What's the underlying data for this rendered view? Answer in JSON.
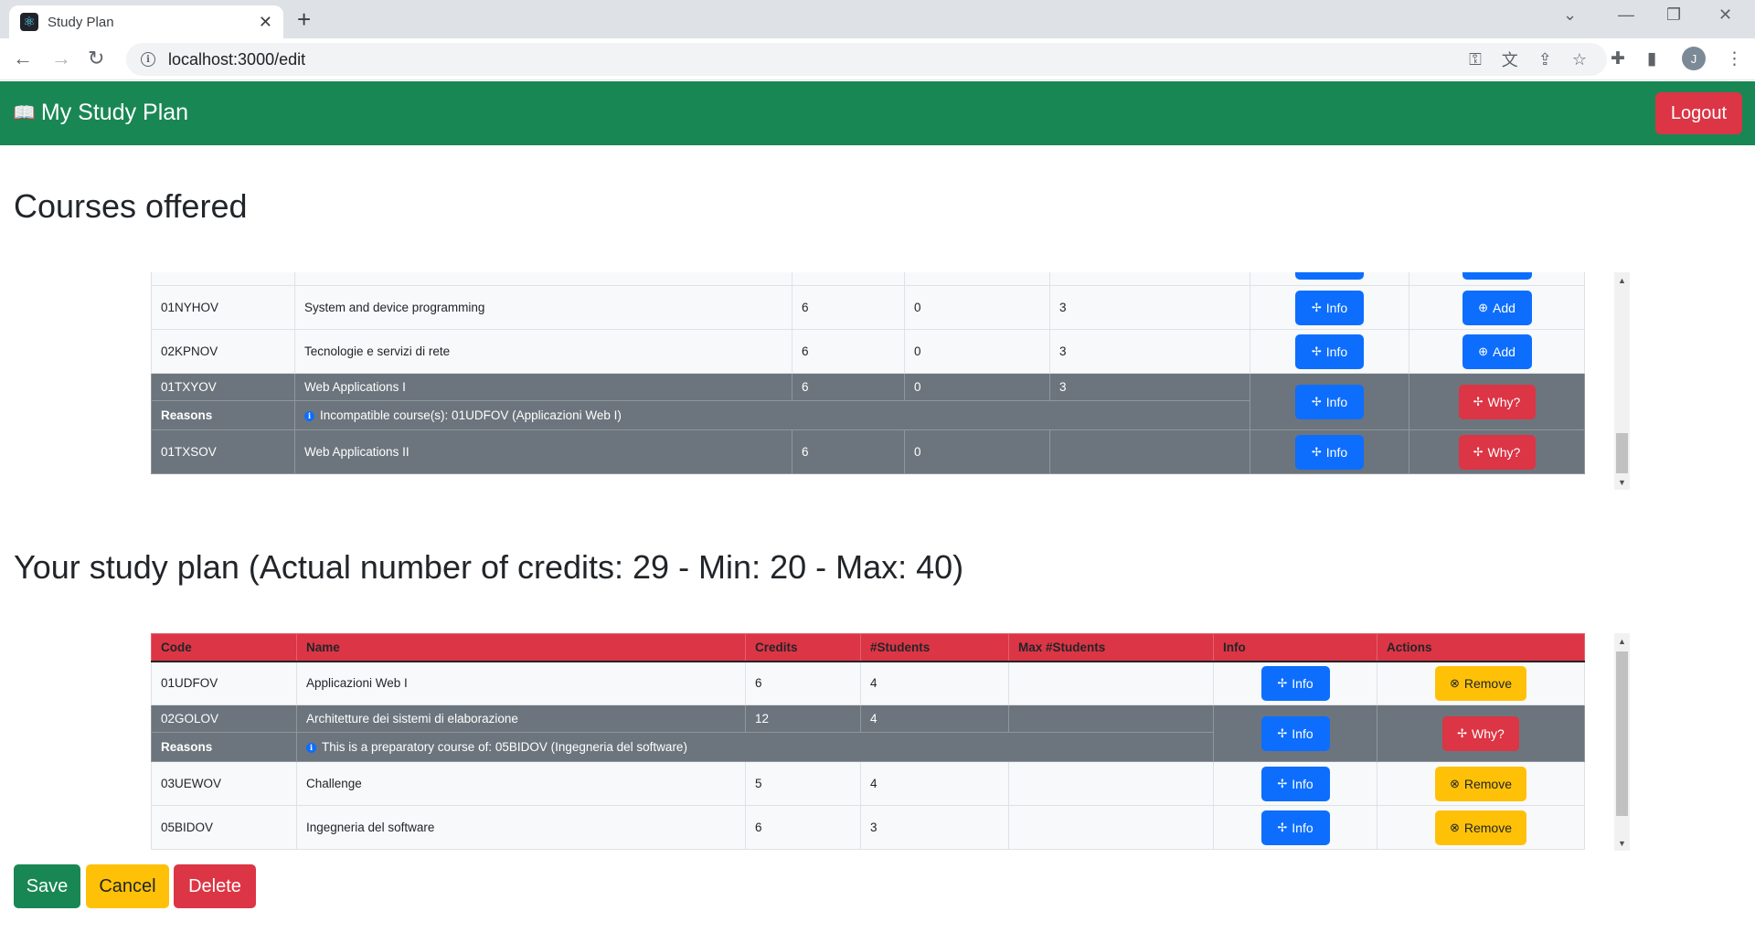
{
  "browser": {
    "tab_title": "Study Plan",
    "url": "localhost:3000/edit"
  },
  "app": {
    "brand": "My Study Plan",
    "logout": "Logout"
  },
  "offered": {
    "heading": "Courses offered",
    "rows": [
      {
        "code": "01NYHOV",
        "name": "System and device programming",
        "credits": "6",
        "students": "0",
        "max": "3",
        "info": "Info",
        "action": "Add"
      },
      {
        "code": "02KPNOV",
        "name": "Tecnologie e servizi di rete",
        "credits": "6",
        "students": "0",
        "max": "3",
        "info": "Info",
        "action": "Add"
      },
      {
        "code": "01TXYOV",
        "name": "Web Applications I",
        "credits": "6",
        "students": "0",
        "max": "3",
        "info": "Info",
        "action": "Why?",
        "reason_label": "Reasons",
        "reason": "Incompatible course(s): 01UDFOV (Applicazioni Web I)"
      },
      {
        "code": "01TXSOV",
        "name": "Web Applications II",
        "credits": "6",
        "students": "0",
        "max": "",
        "info": "Info",
        "action": "Why?"
      }
    ]
  },
  "plan": {
    "heading": "Your study plan (Actual number of credits: 29 - Min: 20 - Max: 40)",
    "columns": [
      "Code",
      "Name",
      "Credits",
      "#Students",
      "Max #Students",
      "Info",
      "Actions"
    ],
    "rows": [
      {
        "code": "01UDFOV",
        "name": "Applicazioni Web I",
        "credits": "6",
        "students": "4",
        "max": "",
        "info": "Info",
        "action": "Remove"
      },
      {
        "code": "02GOLOV",
        "name": "Architetture dei sistemi di elaborazione",
        "credits": "12",
        "students": "4",
        "max": "",
        "info": "Info",
        "action": "Why?",
        "reason_label": "Reasons",
        "reason": "This is a preparatory course of: 05BIDOV (Ingegneria del software)"
      },
      {
        "code": "03UEWOV",
        "name": "Challenge",
        "credits": "5",
        "students": "4",
        "max": "",
        "info": "Info",
        "action": "Remove"
      },
      {
        "code": "05BIDOV",
        "name": "Ingegneria del software",
        "credits": "6",
        "students": "3",
        "max": "",
        "info": "Info",
        "action": "Remove"
      }
    ]
  },
  "buttons": {
    "save": "Save",
    "cancel": "Cancel",
    "delete": "Delete"
  },
  "colors": {
    "navbar": "#198754",
    "danger": "#dc3545",
    "primary": "#0d6efd",
    "warning": "#ffc107",
    "secondary": "#6c757d"
  }
}
